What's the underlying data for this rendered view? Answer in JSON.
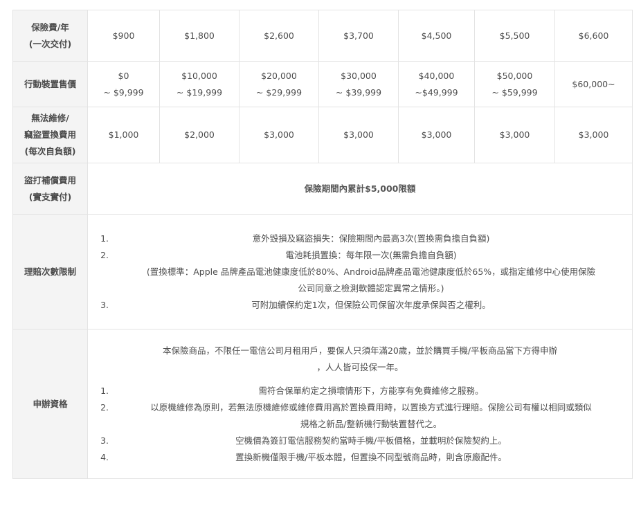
{
  "rows": {
    "premium": {
      "header": "保險費/年\n(一次交付)",
      "cells": [
        "$900",
        "$1,800",
        "$2,600",
        "$3,700",
        "$4,500",
        "$5,500",
        "$6,600"
      ]
    },
    "device_price": {
      "header": "行動裝置售價",
      "cells": [
        "$0\n~ $9,999",
        "$10,000\n~ $19,999",
        "$20,000\n~ $29,999",
        "$30,000\n~ $39,999",
        "$40,000\n~$49,999",
        "$50,000\n~ $59,999",
        "$60,000~"
      ]
    },
    "deductible": {
      "header": "無法維修/\n竊盜置換費用\n(每次自負額)",
      "cells": [
        "$1,000",
        "$2,000",
        "$3,000",
        "$3,000",
        "$3,000",
        "$3,000",
        "$3,000"
      ]
    },
    "theft_call": {
      "header": "盜打補償費用\n(實支實付)",
      "value": "保險期間內累計$5,000限額"
    },
    "claim_limit": {
      "header": "理賠次數限制",
      "items": [
        "意外毀損及竊盜損失：保險期間內最高3次(置換需負擔自負額)",
        "電池耗損置換：每年限一次(無需負擔自負額)",
        "可附加續保約定1次，但保險公司保留次年度承保與否之權利。"
      ],
      "item2_continuation": "(置換標準：Apple 品牌產品電池健康度低於80%、Android品牌產品電池健康度低於65%，或指定維修中心使用保險\n公司同意之檢測軟體認定異常之情形。)"
    },
    "eligibility": {
      "header": "申辦資格",
      "intro": "本保險商品，不限任一電信公司月租用戶，要保人只須年滿20歲，並於購買手機/平板商品當下方得申辦\n，人人皆可投保一年。",
      "items": [
        "需符合保單約定之損壞情形下，方能享有免費維修之服務。",
        "以原機維修為原則，若無法原機維修或維修費用高於置換費用時，以置換方式進行理賠。保險公司有權以相同或類似\n規格之新品/整新機行動裝置替代之。",
        "空機價為簽訂電信服務契約當時手機/平板價格，並載明於保險契約上。",
        "置換新機僅限手機/平板本體，但置換不同型號商品時，則含原廠配件。"
      ]
    }
  }
}
